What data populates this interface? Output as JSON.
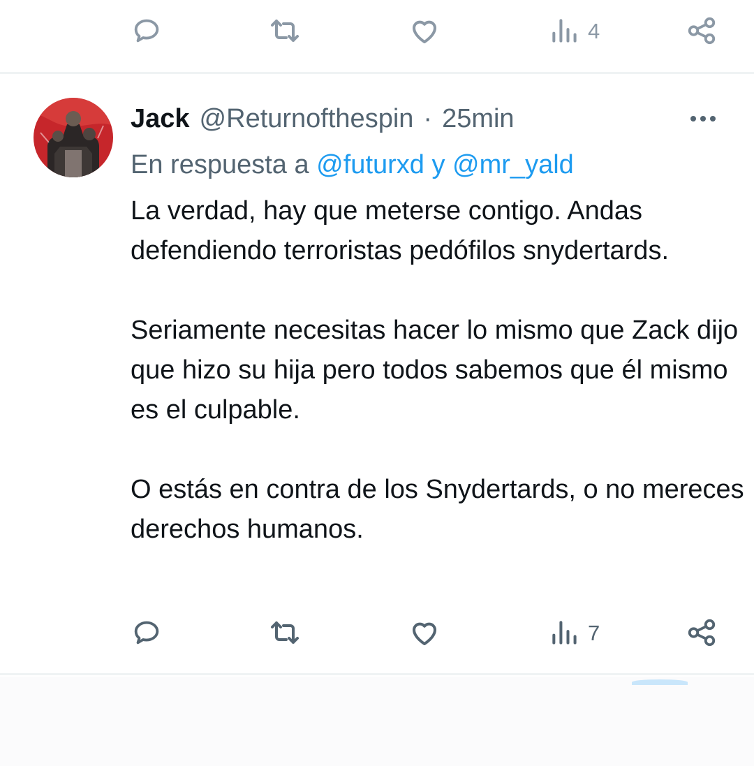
{
  "colors": {
    "text": "#0f1419",
    "secondary": "#536471",
    "accent": "#1d9bf0",
    "divider": "#eff3f4"
  },
  "prev_tweet": {
    "actions": {
      "reply_icon": "reply-icon",
      "retweet_icon": "retweet-icon",
      "like_icon": "like-heart-icon",
      "views_icon": "views-bar-chart-icon",
      "views_count": "4",
      "share_icon": "share-icon"
    }
  },
  "tweet": {
    "author": {
      "name": "Jack",
      "handle": "@Returnofthespin",
      "avatar_icon": "profile-avatar"
    },
    "separator": "·",
    "time": "25min",
    "more_icon": "more-options-icon",
    "reply_to": {
      "prefix": "En respuesta a",
      "mention_1": "@futurxd",
      "conjunction": "y",
      "mention_2": "@mr_yald"
    },
    "paragraphs": [
      "La verdad, hay que meterse contigo. Andas defendiendo terroristas pedófilos snydertards.",
      "Seriamente necesitas hacer lo mismo que Zack dijo que hizo su hija pero todos sabemos que él mismo es el culpable.",
      "O estás en contra de los Snydertards, o no mereces derechos humanos."
    ],
    "actions": {
      "reply_icon": "reply-icon",
      "retweet_icon": "retweet-icon",
      "like_icon": "like-heart-icon",
      "views_icon": "views-bar-chart-icon",
      "views_count": "7",
      "share_icon": "share-icon"
    }
  }
}
